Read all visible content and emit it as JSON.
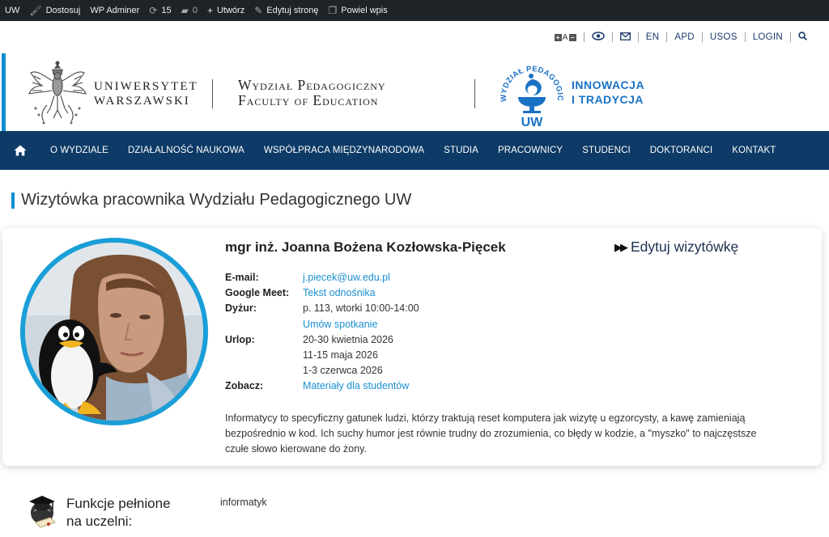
{
  "adminbar": {
    "site": "UW",
    "customize": "Dostosuj",
    "wp_adminer": "WP Adminer",
    "updates_count": "15",
    "comments_count": "0",
    "new": "Utwórz",
    "edit_page": "Edytuj stronę",
    "duplicate": "Powiel wpis"
  },
  "util": {
    "font_label": "A",
    "lang": "EN",
    "apd": "APD",
    "usos": "USOS",
    "login": "LOGIN"
  },
  "brand": {
    "uw_line1": "UNIWERSYTET",
    "uw_line2": "WARSZAWSKI",
    "faculty_line1": "Wydział Pedagogiczny",
    "faculty_line2": "Faculty of Education",
    "logo_arc": "WYDZIAŁ PEDAGOGICZNY",
    "logo_uw": "UW",
    "motto_line1": "INNOWACJA",
    "motto_line2": "I TRADYCJA",
    "accent_color": "#0e8fd0"
  },
  "nav": {
    "items": [
      "O WYDZIALE",
      "DZIAŁALNOŚĆ NAUKOWA",
      "WSPÓŁPRACA MIĘDZYNARODOWA",
      "STUDIA",
      "PRACOWNICY",
      "STUDENCI",
      "DOKTORANCI",
      "KONTAKT"
    ],
    "bg_color": "#0d3a66"
  },
  "page": {
    "title": "Wizytówka pracownika Wydziału Pedagogicznego UW"
  },
  "card": {
    "name": "mgr inż. Joanna Bożena Kozłowska-Pięcek",
    "edit_label": "Edytuj wizytówkę",
    "email_label": "E-mail:",
    "email_value": "j.piecek@uw.edu.pl",
    "meet_label": "Google Meet:",
    "meet_value": "Tekst odnośnika",
    "duty_label": "Dyżur:",
    "duty_value": "p. 113, wtorki 10:00-14:00",
    "duty_link": "Umów spotkanie",
    "leave_label": "Urlop:",
    "leave_values": [
      "20-30 kwietnia 2026",
      "11-15 maja 2026",
      "1-3 czerwca 2026"
    ],
    "see_label": "Zobacz:",
    "see_value": "Materiały dla studentów",
    "description": "Informatycy to specyficzny gatunek ludzi, którzy traktują reset komputera jak wizytę u egzorcysty, a kawę zamieniają bezpośrednio w kod. Ich suchy humor jest równie trudny do zrozumienia, co błędy w kodzie, a \"myszko\" to najczęstsze czułe słowo kierowane do żony.",
    "link_color": "#1a8fd0"
  },
  "functions": {
    "title_line1": "Funkcje pełnione",
    "title_line2": "na uczelni:",
    "value": "informatyk"
  }
}
